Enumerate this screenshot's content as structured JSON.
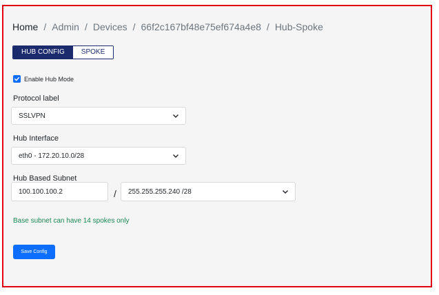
{
  "breadcrumb": {
    "items": [
      "Home",
      "Admin",
      "Devices",
      "66f2c167bf48e75ef674a4e8",
      "Hub-Spoke"
    ],
    "separator": "/"
  },
  "tabs": [
    {
      "label": "HUB CONFIG",
      "active": true
    },
    {
      "label": "SPOKE",
      "active": false
    }
  ],
  "hub_mode": {
    "label": "Enable Hub Mode",
    "checked": true
  },
  "protocol": {
    "label": "Protocol label",
    "value": "SSLVPN"
  },
  "hub_interface": {
    "label": "Hub Interface",
    "value": "eth0 - 172.20.10.0/28"
  },
  "hub_subnet": {
    "label": "Hub Based Subnet",
    "address": "100.100.100.2",
    "separator": "/",
    "mask": "255.255.255.240 /28"
  },
  "hint": "Base subnet can have 14 spokes only",
  "save_label": "Save Config",
  "colors": {
    "frame_border": "#e3000f",
    "tab_active": "#1a2a6c",
    "primary": "#0d6efd",
    "hint": "#198754"
  },
  "icons": {
    "dropdown": "chevron-down-icon",
    "check": "check-icon"
  }
}
